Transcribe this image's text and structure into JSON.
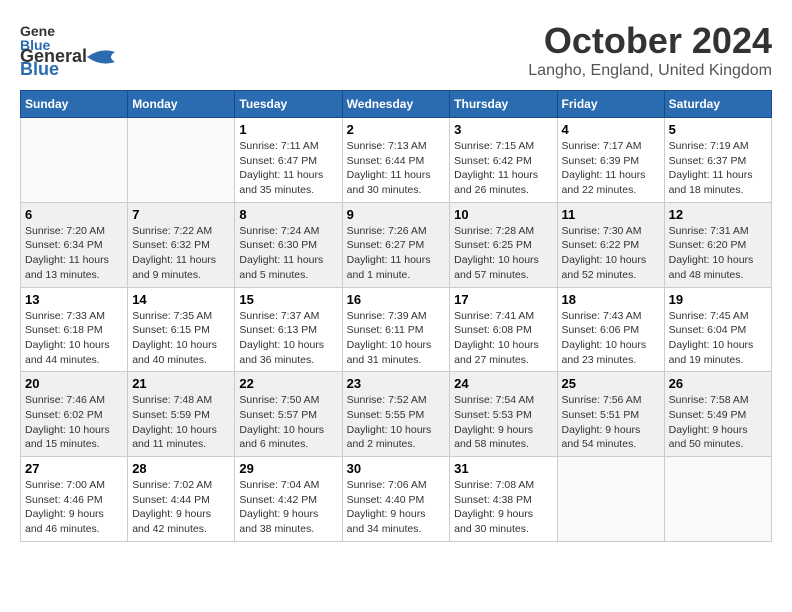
{
  "header": {
    "logo_general": "General",
    "logo_blue": "Blue",
    "month_title": "October 2024",
    "location": "Langho, England, United Kingdom"
  },
  "weekdays": [
    "Sunday",
    "Monday",
    "Tuesday",
    "Wednesday",
    "Thursday",
    "Friday",
    "Saturday"
  ],
  "weeks": [
    [
      {
        "day": "",
        "info": ""
      },
      {
        "day": "",
        "info": ""
      },
      {
        "day": "1",
        "info": "Sunrise: 7:11 AM\nSunset: 6:47 PM\nDaylight: 11 hours\nand 35 minutes."
      },
      {
        "day": "2",
        "info": "Sunrise: 7:13 AM\nSunset: 6:44 PM\nDaylight: 11 hours\nand 30 minutes."
      },
      {
        "day": "3",
        "info": "Sunrise: 7:15 AM\nSunset: 6:42 PM\nDaylight: 11 hours\nand 26 minutes."
      },
      {
        "day": "4",
        "info": "Sunrise: 7:17 AM\nSunset: 6:39 PM\nDaylight: 11 hours\nand 22 minutes."
      },
      {
        "day": "5",
        "info": "Sunrise: 7:19 AM\nSunset: 6:37 PM\nDaylight: 11 hours\nand 18 minutes."
      }
    ],
    [
      {
        "day": "6",
        "info": "Sunrise: 7:20 AM\nSunset: 6:34 PM\nDaylight: 11 hours\nand 13 minutes."
      },
      {
        "day": "7",
        "info": "Sunrise: 7:22 AM\nSunset: 6:32 PM\nDaylight: 11 hours\nand 9 minutes."
      },
      {
        "day": "8",
        "info": "Sunrise: 7:24 AM\nSunset: 6:30 PM\nDaylight: 11 hours\nand 5 minutes."
      },
      {
        "day": "9",
        "info": "Sunrise: 7:26 AM\nSunset: 6:27 PM\nDaylight: 11 hours\nand 1 minute."
      },
      {
        "day": "10",
        "info": "Sunrise: 7:28 AM\nSunset: 6:25 PM\nDaylight: 10 hours\nand 57 minutes."
      },
      {
        "day": "11",
        "info": "Sunrise: 7:30 AM\nSunset: 6:22 PM\nDaylight: 10 hours\nand 52 minutes."
      },
      {
        "day": "12",
        "info": "Sunrise: 7:31 AM\nSunset: 6:20 PM\nDaylight: 10 hours\nand 48 minutes."
      }
    ],
    [
      {
        "day": "13",
        "info": "Sunrise: 7:33 AM\nSunset: 6:18 PM\nDaylight: 10 hours\nand 44 minutes."
      },
      {
        "day": "14",
        "info": "Sunrise: 7:35 AM\nSunset: 6:15 PM\nDaylight: 10 hours\nand 40 minutes."
      },
      {
        "day": "15",
        "info": "Sunrise: 7:37 AM\nSunset: 6:13 PM\nDaylight: 10 hours\nand 36 minutes."
      },
      {
        "day": "16",
        "info": "Sunrise: 7:39 AM\nSunset: 6:11 PM\nDaylight: 10 hours\nand 31 minutes."
      },
      {
        "day": "17",
        "info": "Sunrise: 7:41 AM\nSunset: 6:08 PM\nDaylight: 10 hours\nand 27 minutes."
      },
      {
        "day": "18",
        "info": "Sunrise: 7:43 AM\nSunset: 6:06 PM\nDaylight: 10 hours\nand 23 minutes."
      },
      {
        "day": "19",
        "info": "Sunrise: 7:45 AM\nSunset: 6:04 PM\nDaylight: 10 hours\nand 19 minutes."
      }
    ],
    [
      {
        "day": "20",
        "info": "Sunrise: 7:46 AM\nSunset: 6:02 PM\nDaylight: 10 hours\nand 15 minutes."
      },
      {
        "day": "21",
        "info": "Sunrise: 7:48 AM\nSunset: 5:59 PM\nDaylight: 10 hours\nand 11 minutes."
      },
      {
        "day": "22",
        "info": "Sunrise: 7:50 AM\nSunset: 5:57 PM\nDaylight: 10 hours\nand 6 minutes."
      },
      {
        "day": "23",
        "info": "Sunrise: 7:52 AM\nSunset: 5:55 PM\nDaylight: 10 hours\nand 2 minutes."
      },
      {
        "day": "24",
        "info": "Sunrise: 7:54 AM\nSunset: 5:53 PM\nDaylight: 9 hours\nand 58 minutes."
      },
      {
        "day": "25",
        "info": "Sunrise: 7:56 AM\nSunset: 5:51 PM\nDaylight: 9 hours\nand 54 minutes."
      },
      {
        "day": "26",
        "info": "Sunrise: 7:58 AM\nSunset: 5:49 PM\nDaylight: 9 hours\nand 50 minutes."
      }
    ],
    [
      {
        "day": "27",
        "info": "Sunrise: 7:00 AM\nSunset: 4:46 PM\nDaylight: 9 hours\nand 46 minutes."
      },
      {
        "day": "28",
        "info": "Sunrise: 7:02 AM\nSunset: 4:44 PM\nDaylight: 9 hours\nand 42 minutes."
      },
      {
        "day": "29",
        "info": "Sunrise: 7:04 AM\nSunset: 4:42 PM\nDaylight: 9 hours\nand 38 minutes."
      },
      {
        "day": "30",
        "info": "Sunrise: 7:06 AM\nSunset: 4:40 PM\nDaylight: 9 hours\nand 34 minutes."
      },
      {
        "day": "31",
        "info": "Sunrise: 7:08 AM\nSunset: 4:38 PM\nDaylight: 9 hours\nand 30 minutes."
      },
      {
        "day": "",
        "info": ""
      },
      {
        "day": "",
        "info": ""
      }
    ]
  ]
}
